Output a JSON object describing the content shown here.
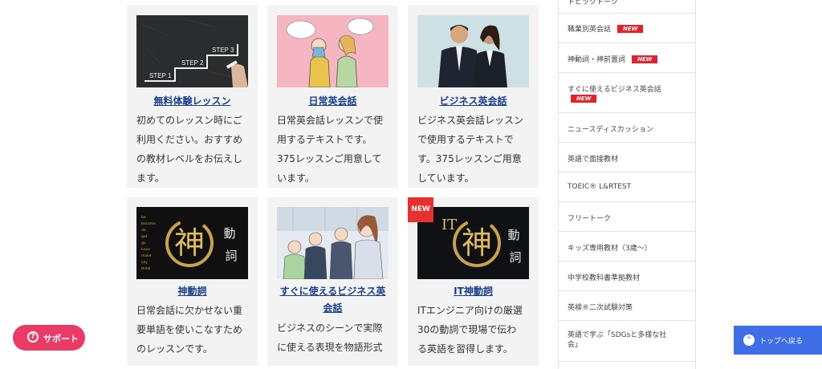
{
  "cards": [
    {
      "title": "無料体験レッスン",
      "desc": [
        "初めてのレッスン時にご",
        "利用ください。おすすめ",
        "の教材レベルをお伝えし",
        "ます。"
      ],
      "image": {
        "steps": [
          "STEP 1",
          "STEP 2",
          "STEP 3"
        ]
      }
    },
    {
      "title": "日常英会話",
      "desc": [
        "日常英会話レッスンで使",
        "用するテキストです。",
        "375レッスンご用意して",
        "います。"
      ]
    },
    {
      "title": "ビジネス英会話",
      "desc": [
        "ビジネス英会話レッスン",
        "で使用するテキストで",
        "す。375レッスンご用意",
        "しています。"
      ]
    },
    {
      "title": "神動詞",
      "desc": [
        "日常会話に欠かせない重",
        "要単語を使いこなすため",
        "のレッスンです。"
      ],
      "image": {
        "kanji_main": "神",
        "kanji_side": [
          "動",
          "詞"
        ],
        "word_list": [
          "be",
          "become",
          "do",
          "get",
          "go",
          "have",
          "make",
          "say",
          "think"
        ]
      }
    },
    {
      "title_lines": [
        "すぐに使えるビジネス英",
        "会話"
      ],
      "desc": [
        "ビジネスのシーンで実際",
        "に使える表現を物語形式"
      ]
    },
    {
      "title": "IT神動詞",
      "desc": [
        "ITエンジニア向けの厳選",
        "30の動詞で現場で伝わ",
        "る英語を習得します。"
      ],
      "badge": "NEW",
      "image": {
        "prefix": "IT",
        "kanji_main": "神",
        "kanji_side": [
          "動",
          "詞"
        ]
      }
    }
  ],
  "sidebar": {
    "items": [
      {
        "label": "トピックトーク"
      },
      {
        "label": "職業別英会話",
        "badge": "NEW"
      },
      {
        "label": "神動詞・神前置詞",
        "badge": "NEW"
      },
      {
        "label": "すぐに使えるビジネス英会話",
        "badge": "NEW"
      },
      {
        "label": "ニュースディスカッション"
      },
      {
        "label": "英語で面接教材"
      },
      {
        "label": "TOEIC® L&RTEST"
      },
      {
        "label": "フリートーク"
      },
      {
        "label": "キッズ専用教材（3歳～）"
      },
      {
        "label": "中学校教科書準拠教材"
      },
      {
        "label": "英検®二次試験対策"
      },
      {
        "label": "英語で学ぶ「SDGsと多様な社",
        "label2": "会」"
      }
    ]
  },
  "support_button": {
    "label": "サポート",
    "icon": "?"
  },
  "to_top_button": {
    "label": "トップへ戻る",
    "icon": "^"
  }
}
